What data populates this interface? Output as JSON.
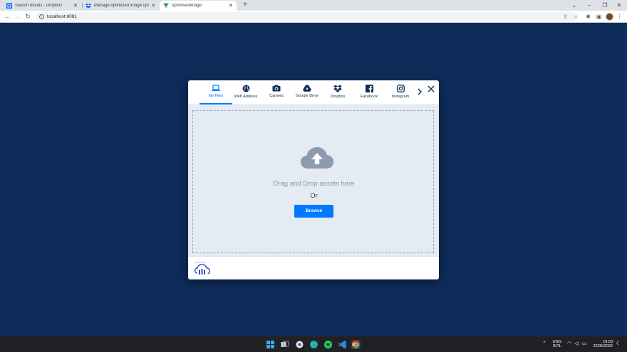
{
  "browser": {
    "tabs": [
      {
        "title": "Search results - Dropbox",
        "favicon": "dropbox-search-favicon"
      },
      {
        "title": "Manage optimized image uploa",
        "favicon": "dropbox-favicon"
      },
      {
        "title": "optimisedimage",
        "favicon": "vue-favicon"
      }
    ],
    "new_tab_label": "+",
    "url": "localhost:8081"
  },
  "widget": {
    "sources": [
      {
        "label": "My Files",
        "icon": "laptop-icon"
      },
      {
        "label": "Web Address",
        "icon": "globe-icon"
      },
      {
        "label": "Camera",
        "icon": "camera-icon"
      },
      {
        "label": "Google Drive",
        "icon": "google-drive-icon"
      },
      {
        "label": "Dropbox",
        "icon": "dropbox-icon"
      },
      {
        "label": "Facebook",
        "icon": "facebook-icon"
      },
      {
        "label": "Instagram",
        "icon": "instagram-icon"
      }
    ],
    "active_source": "My Files",
    "drop_text": "Drag and Drop assets here",
    "or_text": "Or",
    "browse_label": "Browse",
    "powered_by": "powered by",
    "accent_color": "#0078ff",
    "text_color": "#0e2f5a"
  },
  "page": {
    "background_color": "#0e2c5a"
  },
  "taskbar": {
    "language": "ENG",
    "layout": "INTL",
    "time": "19:53",
    "date": "22/05/2022"
  }
}
